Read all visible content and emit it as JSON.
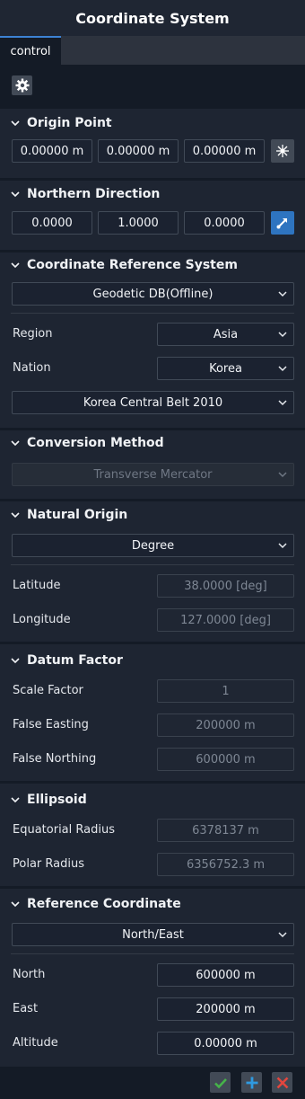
{
  "window": {
    "title": "Coordinate System"
  },
  "tabs": [
    {
      "label": "control"
    }
  ],
  "sections": {
    "origin_point": {
      "title": "Origin Point",
      "values": [
        "0.00000 m",
        "0.00000 m",
        "0.00000 m"
      ]
    },
    "northern_direction": {
      "title": "Northern Direction",
      "values": [
        "0.0000",
        "1.0000",
        "0.0000"
      ]
    },
    "crs": {
      "title": "Coordinate Reference System",
      "source": "Geodetic DB(Offline)",
      "region_label": "Region",
      "region": "Asia",
      "nation_label": "Nation",
      "nation": "Korea",
      "system": "Korea Central Belt 2010"
    },
    "conversion": {
      "title": "Conversion Method",
      "method": "Transverse Mercator"
    },
    "natural_origin": {
      "title": "Natural Origin",
      "unit": "Degree",
      "latitude_label": "Latitude",
      "latitude": "38.0000 [deg]",
      "longitude_label": "Longitude",
      "longitude": "127.0000 [deg]"
    },
    "datum_factor": {
      "title": "Datum Factor",
      "scale_label": "Scale Factor",
      "scale": "1",
      "easting_label": "False Easting",
      "easting": "200000 m",
      "northing_label": "False Northing",
      "northing": "600000 m"
    },
    "ellipsoid": {
      "title": "Ellipsoid",
      "eq_label": "Equatorial Radius",
      "eq": "6378137  m",
      "polar_label": "Polar Radius",
      "polar": "6356752.3  m"
    },
    "reference": {
      "title": "Reference Coordinate",
      "order": "North/East",
      "north_label": "North",
      "north": "600000 m",
      "east_label": "East",
      "east": "200000 m",
      "alt_label": "Altitude",
      "alt": "0.00000 m"
    }
  },
  "colors": {
    "accent": "#3c82d4",
    "ok": "#46b34a",
    "add": "#2f9ae0",
    "cancel": "#e3463e"
  },
  "icons": [
    "gear-icon",
    "chevron-down-icon",
    "crosshair-icon",
    "pick-direction-icon",
    "check-icon",
    "plus-icon",
    "close-icon"
  ]
}
